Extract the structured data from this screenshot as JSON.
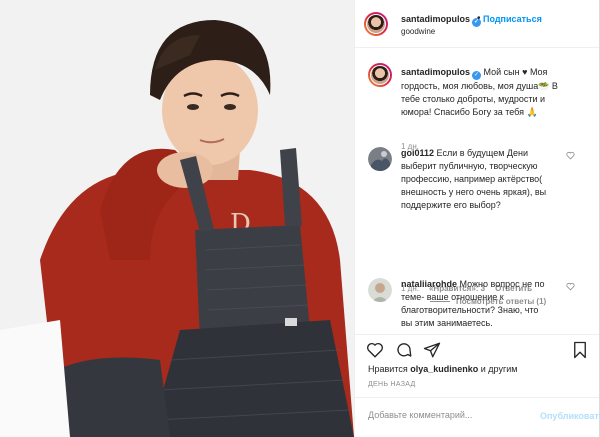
{
  "post": {
    "username": "santadimopulos",
    "follow_separator": "•",
    "follow_label": "Подписаться",
    "location": "goodwine"
  },
  "caption": {
    "username": "santadimopulos",
    "text": "Мой сын ♥ Моя гордость, моя любовь, моя душа🥗 В тебе столько доброты, мудрости и юмора! Спасибо Богу за тебя 🙏",
    "time": "1 дн."
  },
  "comments": [
    {
      "username": "goi0112",
      "text": "Если в будущем Дени выберит публичную, творческую профессию, например актёрство( внешность у него очень яркая), вы поддержите его выбор?",
      "time": "1 дн.",
      "likes": "«Нравится»: 3",
      "reply": "Ответить",
      "see_replies": "Посмотреть ответы (1)"
    },
    {
      "username": "nataliiarohde",
      "text": "Можно вопрос не по теме- ваше отношение к благотворительности? Знаю, что вы этим занимаетесь."
    }
  ],
  "likes_line": {
    "prefix": "Нравится",
    "user": "olya_kudinenko",
    "suffix": "и другим"
  },
  "timestamp": "ДЕНЬ НАЗАД",
  "add_comment": {
    "placeholder": "Добавьте комментарий...",
    "publish_label": "Опубликовать"
  },
  "colors": {
    "accent": "#0095f6",
    "publish_disabled": "#b2dffc",
    "muted": "#8e8e8e"
  }
}
